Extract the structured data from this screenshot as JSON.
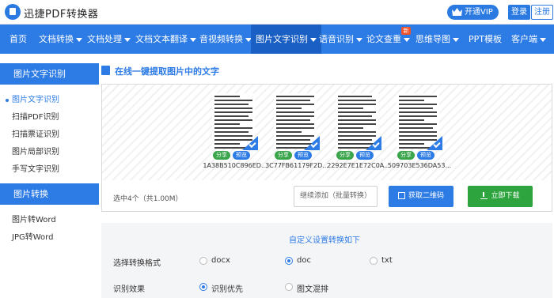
{
  "header": {
    "app_name": "迅捷PDF转换器",
    "vip_label": "开通VIP",
    "login_label": "登录",
    "register_label": "注册"
  },
  "nav": {
    "items": [
      {
        "label": "首页",
        "caret": false
      },
      {
        "label": "文档转换",
        "caret": true
      },
      {
        "label": "文档处理",
        "caret": true
      },
      {
        "label": "文档文本翻译",
        "caret": true
      },
      {
        "label": "音视频转换",
        "caret": true
      },
      {
        "label": "图片文字识别",
        "caret": true,
        "active": true
      },
      {
        "label": "语音识别",
        "caret": true
      },
      {
        "label": "论文查重",
        "caret": true,
        "badge": "新"
      },
      {
        "label": "思维导图",
        "caret": true
      },
      {
        "label": "PPT模板",
        "caret": false
      },
      {
        "label": "客户端",
        "caret": true
      }
    ]
  },
  "sidebar": {
    "section1": "图片文字识别",
    "items1": [
      "图片文字识别",
      "扫描PDF识别",
      "扫描票证识别",
      "图片局部识别",
      "手写文字识别"
    ],
    "section2": "图片转换",
    "items2": [
      "图片转Word",
      "JPG转Word"
    ]
  },
  "main": {
    "title": "在线一键提取图片中的文字",
    "files": [
      {
        "name": "1A38B510C896ED...",
        "share": "分享",
        "preview": "预览"
      },
      {
        "name": "3C77FB61179F2D...",
        "share": "分享",
        "preview": "预览"
      },
      {
        "name": "2292E7E1E72C0A...",
        "share": "分享",
        "preview": "预览"
      },
      {
        "name": "509703E536DA53...",
        "share": "分享",
        "preview": "预览"
      }
    ],
    "selected_count": "选中4个（共1.00M）",
    "continue_label": "继续添加（批量转换）",
    "qr_label": "获取二维码",
    "download_label": "立即下载"
  },
  "settings": {
    "title": "自定义设置转换如下",
    "format_label": "选择转换格式",
    "formats": [
      "docx",
      "doc",
      "txt"
    ],
    "selected_format": "doc",
    "effect_label": "识别效果",
    "effects": [
      "识别优先",
      "图文混排"
    ],
    "selected_effect": "识别优先"
  },
  "colors": {
    "primary": "#2d7be5",
    "primary_dark": "#1a5fc4",
    "green": "#2ea43f",
    "badge": "#f0522b"
  }
}
